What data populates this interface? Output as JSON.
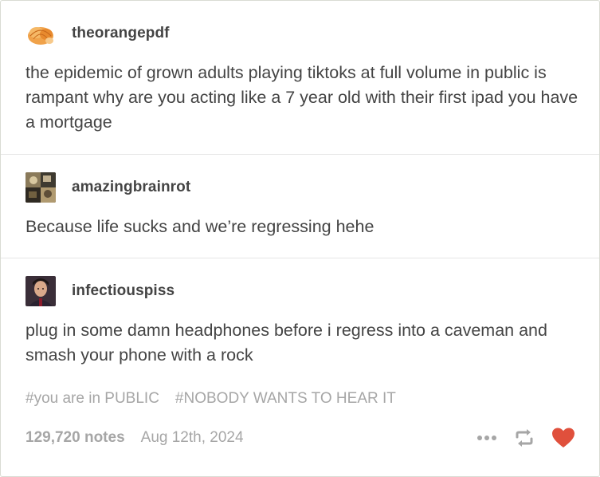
{
  "posts": [
    {
      "username": "theorangepdf",
      "text": "the epidemic of grown adults playing tiktoks at full volume in public is rampant why are you acting like a 7 year old with their first ipad you have a mortgage",
      "avatar_icon": "orange-shell-avatar"
    },
    {
      "username": "amazingbrainrot",
      "text": "Because life sucks and we’re regressing hehe",
      "avatar_icon": "collage-avatar"
    },
    {
      "username": "infectiouspiss",
      "text": "plug in some damn headphones before i regress into a caveman and smash your phone with a rock",
      "avatar_icon": "portrait-avatar"
    }
  ],
  "tags": [
    "#you are in PUBLIC",
    "#NOBODY WANTS TO HEAR IT"
  ],
  "footer": {
    "notes": "129,720 notes",
    "date": "Aug 12th, 2024",
    "more_icon": "ellipsis-icon",
    "reblog_icon": "reblog-icon",
    "like_icon": "heart-icon"
  },
  "colors": {
    "text": "#444444",
    "muted": "#a6a6a6",
    "heart": "#e0503c",
    "border": "#d9dcd3"
  }
}
